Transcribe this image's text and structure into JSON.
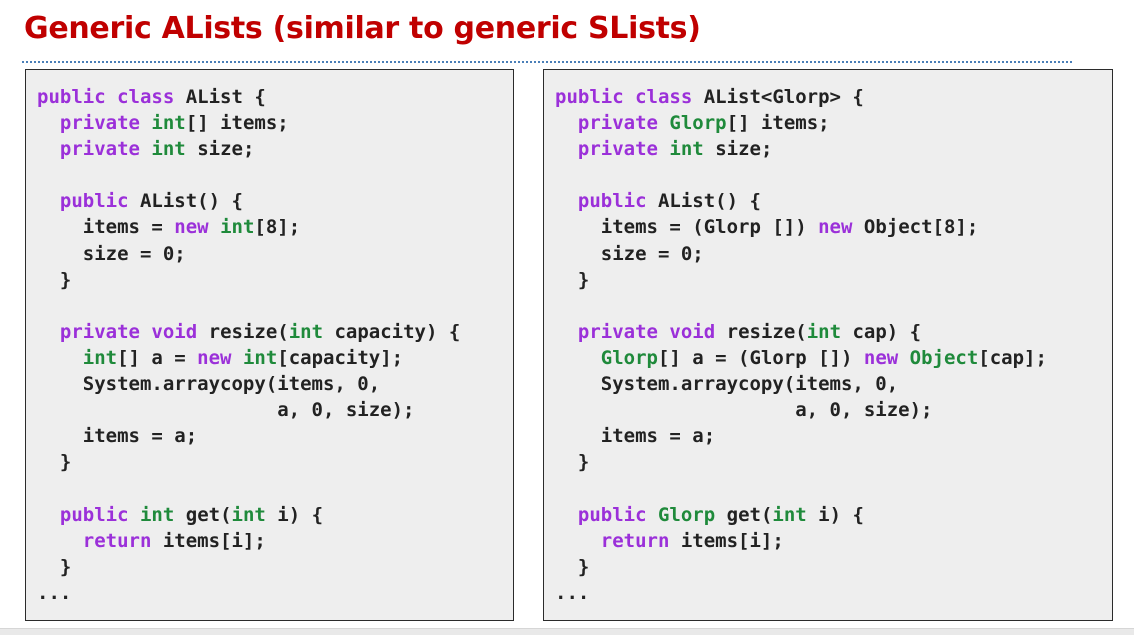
{
  "slide": {
    "title": "Generic ALists (similar to generic SLists)"
  },
  "colors": {
    "title": "#c00000",
    "keyword": "#9b30d9",
    "type": "#1f8a3b",
    "plain": "#222222",
    "box_background": "#eeeeee",
    "rule": "#4a7fb8"
  },
  "left_code": {
    "lines": [
      [
        {
          "t": "public class",
          "c": "kw"
        },
        {
          "t": " AList {",
          "c": ""
        }
      ],
      [
        {
          "t": "  ",
          "c": ""
        },
        {
          "t": "private",
          "c": "kw"
        },
        {
          "t": " ",
          "c": ""
        },
        {
          "t": "int",
          "c": "ty"
        },
        {
          "t": "[] items;",
          "c": ""
        }
      ],
      [
        {
          "t": "  ",
          "c": ""
        },
        {
          "t": "private",
          "c": "kw"
        },
        {
          "t": " ",
          "c": ""
        },
        {
          "t": "int",
          "c": "ty"
        },
        {
          "t": " size;",
          "c": ""
        }
      ],
      [
        {
          "t": "",
          "c": ""
        }
      ],
      [
        {
          "t": "  ",
          "c": ""
        },
        {
          "t": "public",
          "c": "kw"
        },
        {
          "t": " AList() {",
          "c": ""
        }
      ],
      [
        {
          "t": "    items = ",
          "c": ""
        },
        {
          "t": "new",
          "c": "kw"
        },
        {
          "t": " ",
          "c": ""
        },
        {
          "t": "int",
          "c": "ty"
        },
        {
          "t": "[8];",
          "c": ""
        }
      ],
      [
        {
          "t": "    size = 0;",
          "c": ""
        }
      ],
      [
        {
          "t": "  }",
          "c": ""
        }
      ],
      [
        {
          "t": "",
          "c": ""
        }
      ],
      [
        {
          "t": "  ",
          "c": ""
        },
        {
          "t": "private",
          "c": "kw"
        },
        {
          "t": " ",
          "c": ""
        },
        {
          "t": "void",
          "c": "kw"
        },
        {
          "t": " resize(",
          "c": ""
        },
        {
          "t": "int",
          "c": "ty"
        },
        {
          "t": " capacity) {",
          "c": ""
        }
      ],
      [
        {
          "t": "    ",
          "c": ""
        },
        {
          "t": "int",
          "c": "ty"
        },
        {
          "t": "[] a = ",
          "c": ""
        },
        {
          "t": "new",
          "c": "kw"
        },
        {
          "t": " ",
          "c": ""
        },
        {
          "t": "int",
          "c": "ty"
        },
        {
          "t": "[capacity];",
          "c": ""
        }
      ],
      [
        {
          "t": "    System.arraycopy(items, 0,",
          "c": ""
        }
      ],
      [
        {
          "t": "                     a, 0, size);",
          "c": ""
        }
      ],
      [
        {
          "t": "    items = a;",
          "c": ""
        }
      ],
      [
        {
          "t": "  }",
          "c": ""
        }
      ],
      [
        {
          "t": "",
          "c": ""
        }
      ],
      [
        {
          "t": "  ",
          "c": ""
        },
        {
          "t": "public",
          "c": "kw"
        },
        {
          "t": " ",
          "c": ""
        },
        {
          "t": "int",
          "c": "ty"
        },
        {
          "t": " get(",
          "c": ""
        },
        {
          "t": "int",
          "c": "ty"
        },
        {
          "t": " i) {",
          "c": ""
        }
      ],
      [
        {
          "t": "    ",
          "c": ""
        },
        {
          "t": "return",
          "c": "kw"
        },
        {
          "t": " items[i];",
          "c": ""
        }
      ],
      [
        {
          "t": "  }",
          "c": ""
        }
      ],
      [
        {
          "t": "...",
          "c": ""
        }
      ]
    ]
  },
  "right_code": {
    "lines": [
      [
        {
          "t": "public class",
          "c": "kw"
        },
        {
          "t": " AList<Glorp> {",
          "c": ""
        }
      ],
      [
        {
          "t": "  ",
          "c": ""
        },
        {
          "t": "private",
          "c": "kw"
        },
        {
          "t": " ",
          "c": ""
        },
        {
          "t": "Glorp",
          "c": "ty"
        },
        {
          "t": "[] items;",
          "c": ""
        }
      ],
      [
        {
          "t": "  ",
          "c": ""
        },
        {
          "t": "private",
          "c": "kw"
        },
        {
          "t": " ",
          "c": ""
        },
        {
          "t": "int",
          "c": "ty"
        },
        {
          "t": " size;",
          "c": ""
        }
      ],
      [
        {
          "t": "",
          "c": ""
        }
      ],
      [
        {
          "t": "  ",
          "c": ""
        },
        {
          "t": "public",
          "c": "kw"
        },
        {
          "t": " AList() {",
          "c": ""
        }
      ],
      [
        {
          "t": "    items = (Glorp []) ",
          "c": ""
        },
        {
          "t": "new",
          "c": "kw"
        },
        {
          "t": " Object[8];",
          "c": ""
        }
      ],
      [
        {
          "t": "    size = 0;",
          "c": ""
        }
      ],
      [
        {
          "t": "  }",
          "c": ""
        }
      ],
      [
        {
          "t": "",
          "c": ""
        }
      ],
      [
        {
          "t": "  ",
          "c": ""
        },
        {
          "t": "private",
          "c": "kw"
        },
        {
          "t": " ",
          "c": ""
        },
        {
          "t": "void",
          "c": "kw"
        },
        {
          "t": " resize(",
          "c": ""
        },
        {
          "t": "int",
          "c": "ty"
        },
        {
          "t": " cap) {",
          "c": ""
        }
      ],
      [
        {
          "t": "    ",
          "c": ""
        },
        {
          "t": "Glorp",
          "c": "ty"
        },
        {
          "t": "[] a = (Glorp []) ",
          "c": ""
        },
        {
          "t": "new",
          "c": "kw"
        },
        {
          "t": " ",
          "c": ""
        },
        {
          "t": "Object",
          "c": "ty"
        },
        {
          "t": "[cap];",
          "c": ""
        }
      ],
      [
        {
          "t": "    System.arraycopy(items, 0,",
          "c": ""
        }
      ],
      [
        {
          "t": "                     a, 0, size);",
          "c": ""
        }
      ],
      [
        {
          "t": "    items = a;",
          "c": ""
        }
      ],
      [
        {
          "t": "  }",
          "c": ""
        }
      ],
      [
        {
          "t": "",
          "c": ""
        }
      ],
      [
        {
          "t": "  ",
          "c": ""
        },
        {
          "t": "public",
          "c": "kw"
        },
        {
          "t": " ",
          "c": ""
        },
        {
          "t": "Glorp",
          "c": "ty"
        },
        {
          "t": " get(",
          "c": ""
        },
        {
          "t": "int",
          "c": "ty"
        },
        {
          "t": " i) {",
          "c": ""
        }
      ],
      [
        {
          "t": "    ",
          "c": ""
        },
        {
          "t": "return",
          "c": "kw"
        },
        {
          "t": " items[i];",
          "c": ""
        }
      ],
      [
        {
          "t": "  }",
          "c": ""
        }
      ],
      [
        {
          "t": "...",
          "c": ""
        }
      ]
    ]
  }
}
